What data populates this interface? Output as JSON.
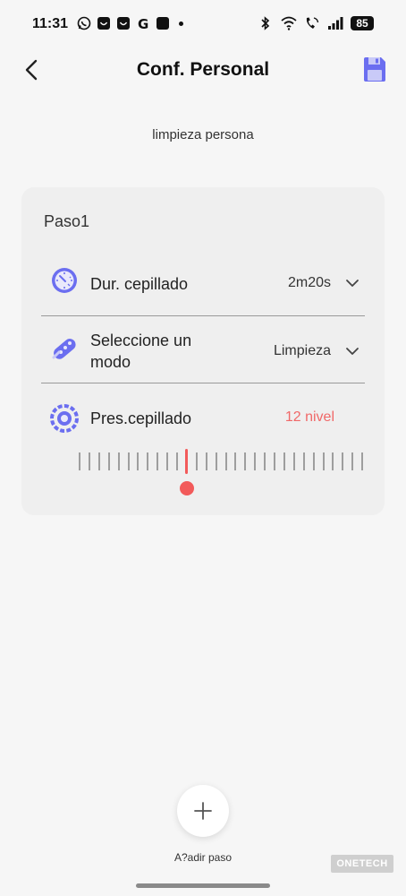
{
  "status_bar": {
    "time": "11:31",
    "battery": "85",
    "notification_icons": [
      "whatsapp-icon",
      "app-icon",
      "app-icon",
      "g-icon",
      "app-icon"
    ],
    "system_icons": [
      "bluetooth-icon",
      "wifi-icon",
      "wifi-calling-icon",
      "signal-icon"
    ]
  },
  "header": {
    "title": "Conf. Personal",
    "back_icon": "chevron-left-icon",
    "save_icon": "floppy-disk-icon"
  },
  "subtitle": "limpieza persona",
  "card": {
    "step_title": "Paso1",
    "rows": [
      {
        "icon": "timer-icon",
        "label": "Dur. cepillado",
        "value": "2m20s"
      },
      {
        "icon": "brush-head-icon",
        "label_line1": "Seleccione un",
        "label_line2": "modo",
        "value": "Limpieza"
      },
      {
        "icon": "pressure-icon",
        "label": "Pres.cepillado",
        "value": "12 nivel"
      }
    ],
    "slider": {
      "level": 12,
      "min": 1,
      "max": 30
    }
  },
  "add_step": {
    "label": "A?adir paso"
  },
  "watermark": "ONETECH",
  "colors": {
    "accent": "#6b6ef0",
    "highlight": "#f25a5a"
  }
}
